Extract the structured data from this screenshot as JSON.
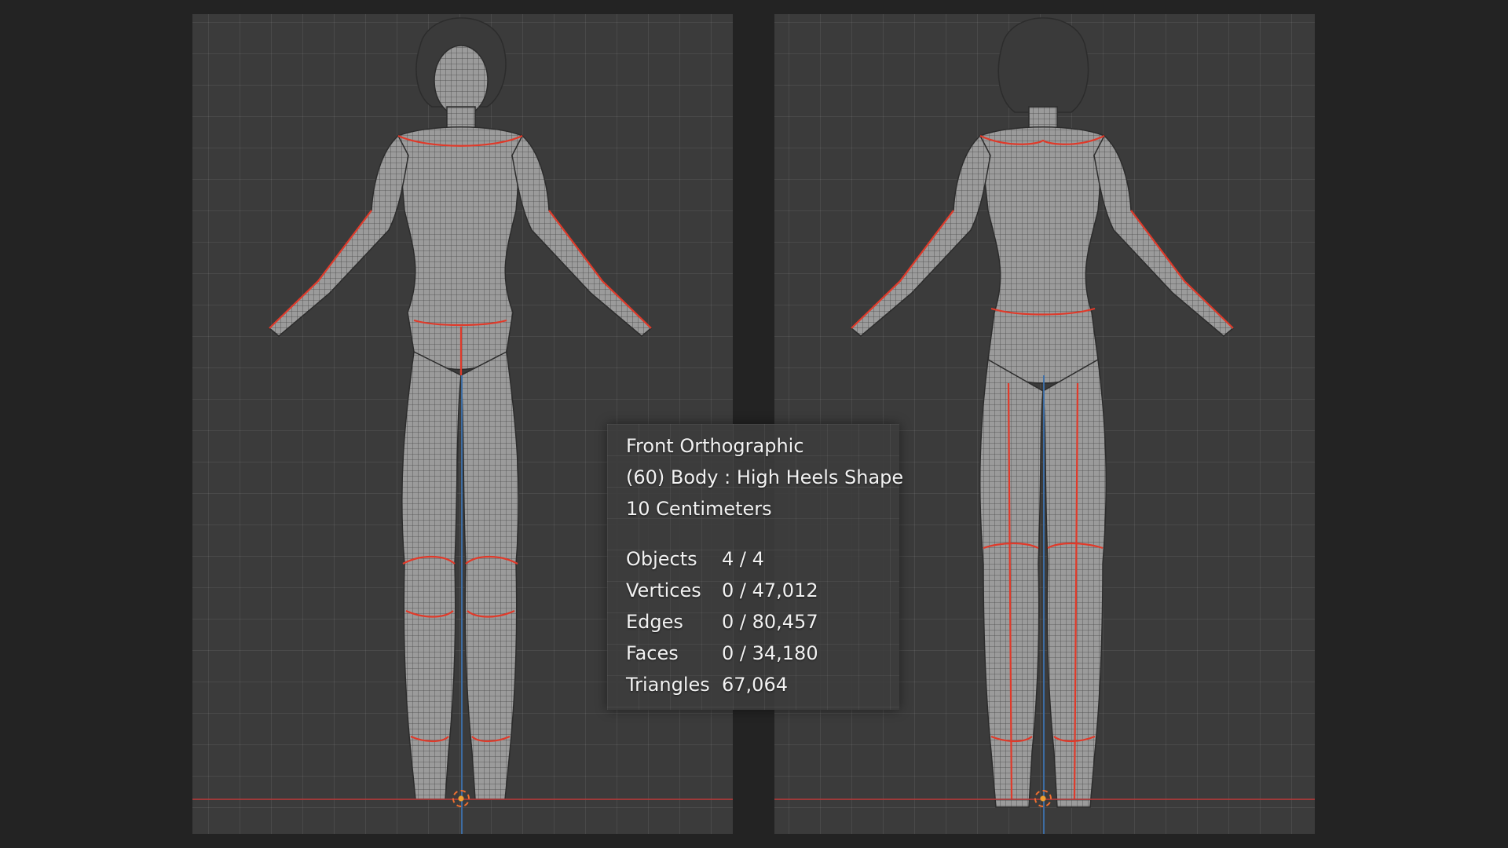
{
  "viewport_overlay": {
    "view_name": "Front Orthographic",
    "object_info": "(60) Body : High Heels Shape",
    "grid_scale": "10 Centimeters",
    "stats": [
      {
        "label": "Objects",
        "value": "4 / 4"
      },
      {
        "label": "Vertices",
        "value": "0 / 47,012"
      },
      {
        "label": "Edges",
        "value": "0 / 80,457"
      },
      {
        "label": "Faces",
        "value": "0 / 34,180"
      },
      {
        "label": "Triangles",
        "value": "67,064"
      }
    ]
  },
  "colors": {
    "background": "#232323",
    "viewport": "#3b3b3b",
    "mesh": "#9a9a9a",
    "seam": "#e03a2a",
    "x_axis": "#a83a3a",
    "z_axis": "#3d6fa8",
    "cursor": "#f07030"
  },
  "icons": [
    "3d-cursor-icon"
  ]
}
